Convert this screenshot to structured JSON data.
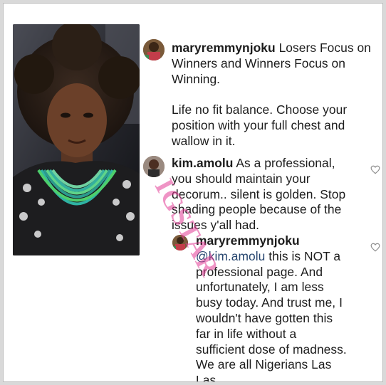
{
  "comments": [
    {
      "username": "maryremmynjoku",
      "lines": [
        "Losers Focus on",
        "Winners and Winners Focus on",
        "Winning.",
        "",
        "Life no fit balance. Choose your",
        "position with your full chest and",
        "wallow in it."
      ]
    },
    {
      "username": "kim.amolu",
      "lines": [
        "As a professional,",
        "you should maintain your",
        "decorum.. silent is golden. Stop",
        "shading people because of the",
        "issues y'all had."
      ]
    },
    {
      "username": "maryremmynjoku",
      "mention": "@kim.amolu",
      "lines": [
        "this is NOT a",
        "professional page. And",
        "unfortunately, I am less",
        "busy today. And trust me, I",
        "wouldn't have gotten this",
        "far in life without a",
        "sufficient dose of madness.",
        "We are all Nigerians Las",
        "Las."
      ]
    }
  ],
  "watermark": "IGSTAR",
  "icons": {
    "like": "heart-outline-icon"
  },
  "colors": {
    "watermark": "#e23c96",
    "text": "#1c1c1c",
    "heart": "#8e8e8e"
  }
}
